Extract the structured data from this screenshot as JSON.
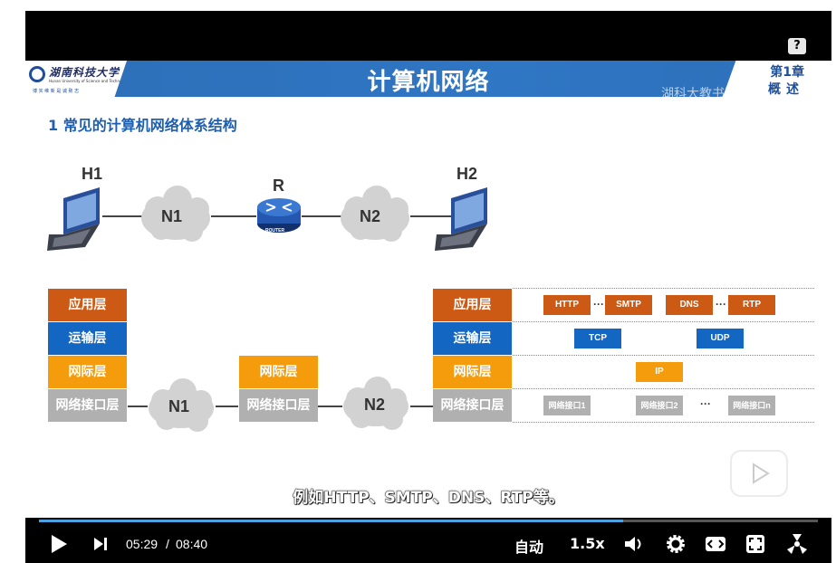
{
  "slide": {
    "logo_text": "湖南科技大学",
    "logo_sub": "Hunan University of Science and Technology",
    "logo_motto": "博 实 维 新    是 诚 致 志",
    "title": "计算机网络",
    "chapter_line1": "第1章",
    "chapter_line2": "概述",
    "watermark": "湖科大教书匠",
    "section_title": "1 常见的计算机网络体系结构"
  },
  "diagram": {
    "h1_label": "H1",
    "h2_label": "H2",
    "router_label": "R",
    "router_caption": "ROUTER",
    "cloud_n1": "N1",
    "cloud_n2": "N2",
    "layers": {
      "app": "应用层",
      "transport": "运输层",
      "internet": "网际层",
      "interface": "网络接口层"
    },
    "protocols": {
      "http": "HTTP",
      "smtp": "SMTP",
      "dns": "DNS",
      "rtp": "RTP",
      "tcp": "TCP",
      "udp": "UDP",
      "ip": "IP",
      "if1": "网络接口1",
      "if2": "网络接口2",
      "ifn": "网络接口n",
      "ellipsis": "···"
    }
  },
  "subtitle": "例如HTTP、SMTP、DNS、RTP等。",
  "player": {
    "current_time": "05:29",
    "separator": "/",
    "total_time": "08:40",
    "progress_fraction": 0.75,
    "quality": "自动",
    "speed": "1.5x",
    "help": "?"
  },
  "colors": {
    "app_layer": "#cc5a14",
    "transport_layer": "#1366c2",
    "internet_layer": "#f59c0c",
    "interface_layer": "#b0b0b0",
    "banner": "#2f76c4",
    "progress": "#4aa3df"
  },
  "icons": [
    "play-icon",
    "next-icon",
    "volume-icon",
    "settings-icon",
    "widescreen-icon",
    "fullscreen-icon",
    "danmaku-icon",
    "help-icon"
  ]
}
